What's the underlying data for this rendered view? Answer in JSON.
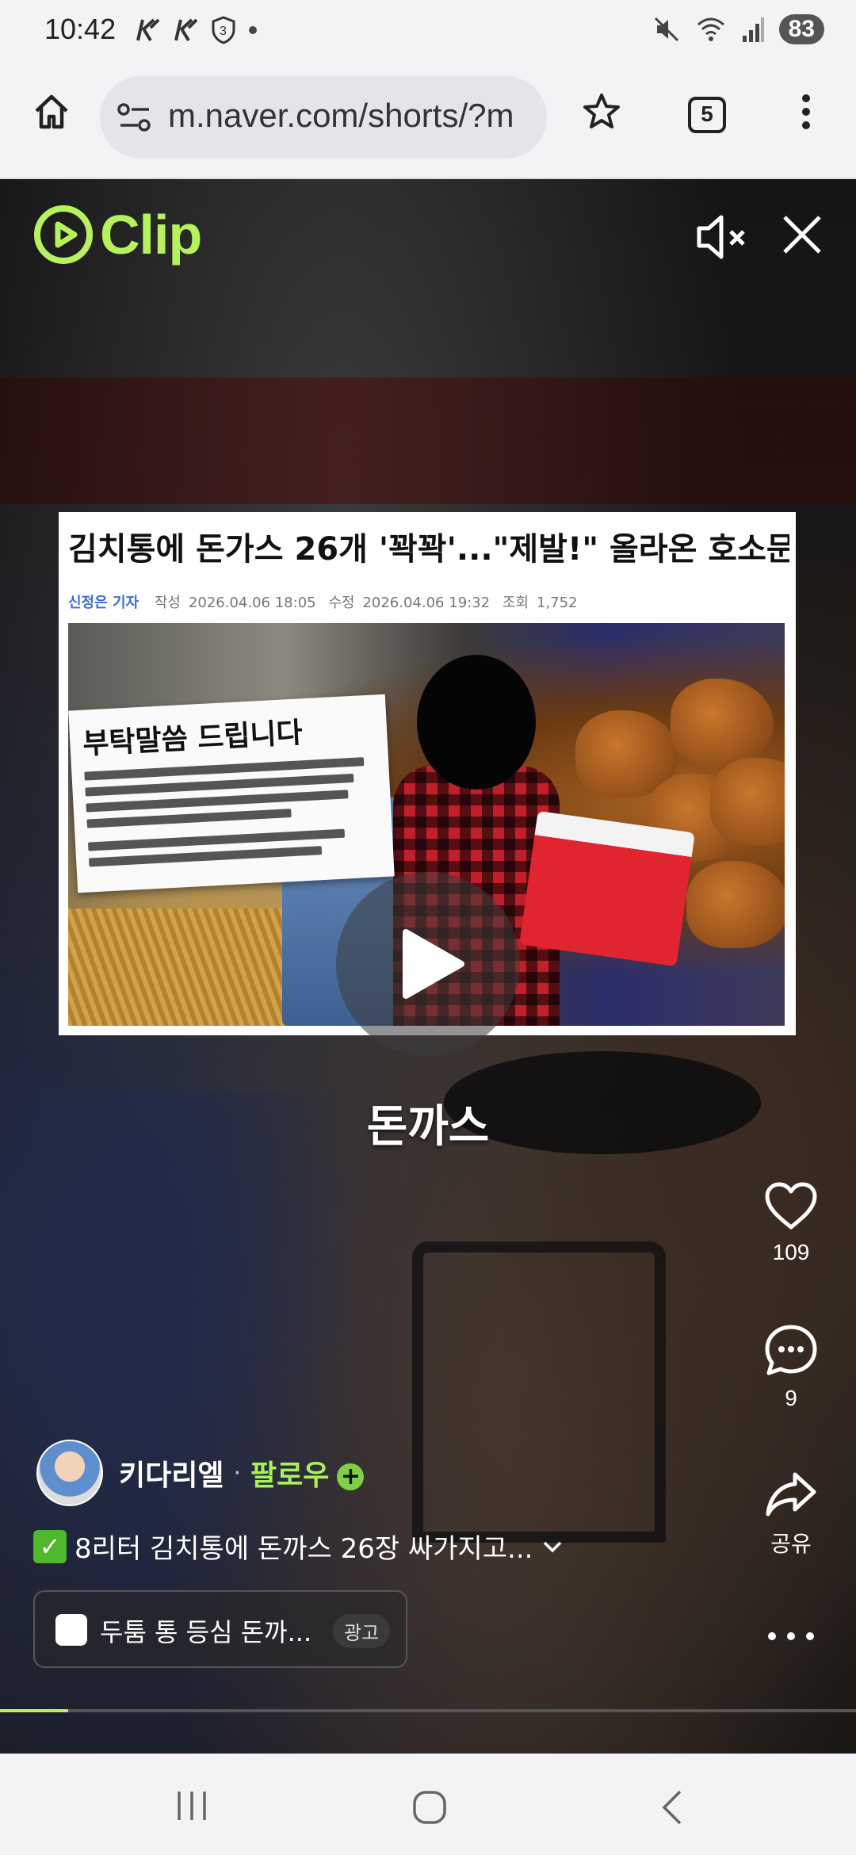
{
  "status_bar": {
    "time": "10:42",
    "battery": "83",
    "left_icon_names": [
      "k-sport-icon",
      "k-sport-icon",
      "shield-3-icon",
      "dot-icon"
    ],
    "right_icon_names": [
      "mute-icon",
      "wifi-icon",
      "signal-icon",
      "battery-icon"
    ]
  },
  "browser": {
    "url": "m.naver.com/shorts/?m",
    "tab_count": "5"
  },
  "player": {
    "logo_text": "Clip",
    "accent_color": "#b6f25d",
    "muted": true
  },
  "news_card": {
    "headline": "김치통에 돈가스 26개 '꽉꽉'...\"제발!\" 올라온 호소문",
    "reporter": "신정은 기자",
    "created_label": "작성",
    "created": "2026.04.06 18:05",
    "modified_label": "수정",
    "modified": "2026.04.06 19:32",
    "views_label": "조회",
    "views": "1,752",
    "notice_title": "부탁말씀 드립니다"
  },
  "subtitle": "돈까스",
  "rail": {
    "likes": "109",
    "comments": "9",
    "share_label": "공유"
  },
  "channel": {
    "name": "키다리엘",
    "separator": "·",
    "follow_label": "팔로우"
  },
  "caption": "8리터 김치통에 돈까스 26장 싸가지고...",
  "ad": {
    "text": "두툼 통 등심 돈까...",
    "badge": "광고"
  },
  "progress": {
    "fraction": 0.08
  }
}
